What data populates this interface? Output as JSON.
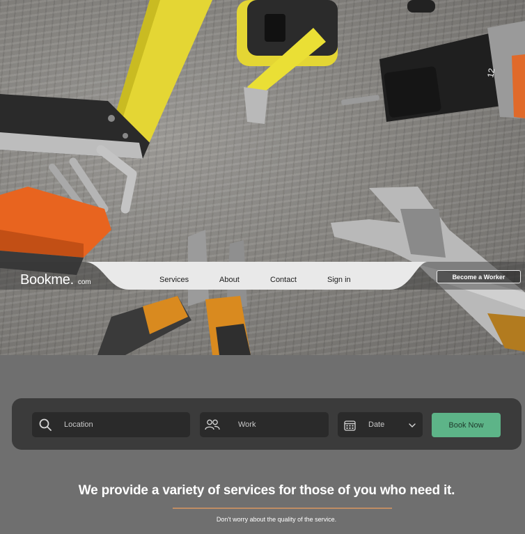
{
  "brand": {
    "name": "Bookme.",
    "domain": "com"
  },
  "nav": {
    "items": [
      {
        "label": "Services"
      },
      {
        "label": "About"
      },
      {
        "label": "Contact"
      },
      {
        "label": "Sign in"
      }
    ],
    "cta_label": "Become a Worker"
  },
  "search": {
    "location_placeholder": "Location",
    "work_placeholder": "Work",
    "date_label": "Date",
    "book_label": "Book Now"
  },
  "tagline": {
    "headline": "We provide a variety of services for those of you who need it.",
    "sub": "Don't worry about the quality of the service."
  },
  "colors": {
    "accent_green": "#5db488",
    "divider_orange": "#c08d64",
    "panel_dark": "#3b3b3b"
  },
  "icons": [
    "search-icon",
    "people-icon",
    "calendar-icon",
    "chevron-down-icon"
  ]
}
